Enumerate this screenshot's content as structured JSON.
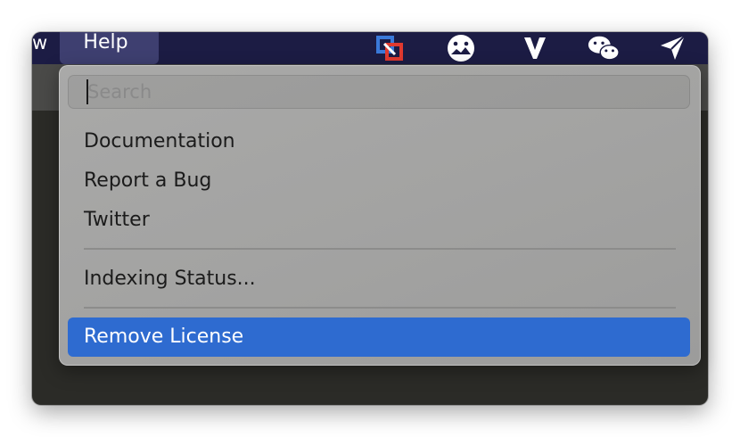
{
  "menubar": {
    "view_partial": "w",
    "help_label": "Help",
    "status_icons": [
      "parallels-icon",
      "screenshot-app-icon",
      "vectorize-icon",
      "wechat-icon",
      "send-arrow-icon"
    ]
  },
  "menu": {
    "search_placeholder": "Search",
    "items": [
      {
        "label": "Documentation"
      },
      {
        "label": "Report a Bug"
      },
      {
        "label": "Twitter"
      },
      {
        "label": "Indexing Status..."
      },
      {
        "label": "Remove License"
      }
    ]
  },
  "colors": {
    "menubar": "#1c1c44",
    "help_highlight": "#3e3f70",
    "selection": "#2e6bd0",
    "menu_bg": "#a5a5a4"
  }
}
